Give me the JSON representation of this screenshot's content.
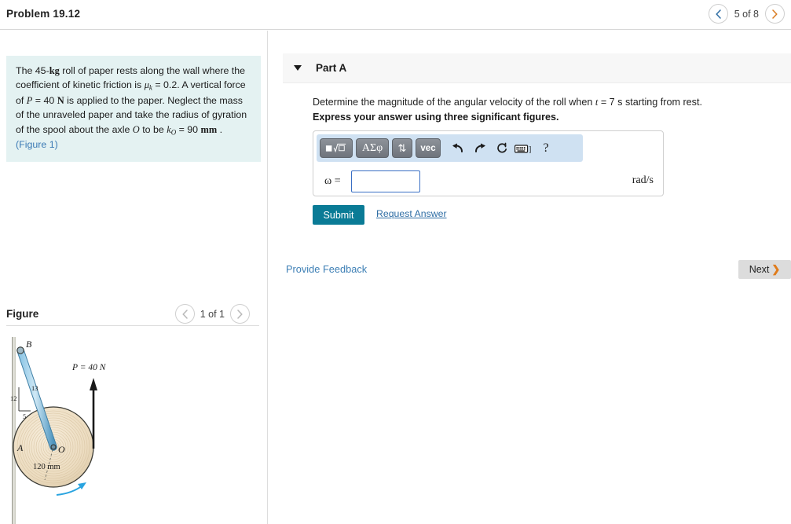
{
  "header": {
    "problem_title": "Problem 19.12",
    "prev_icon": "chevron-left-icon",
    "next_icon": "chevron-right-icon",
    "pager_label": "5 of 8"
  },
  "statement": {
    "line1_a": "The 45-",
    "line1_kg": "kg",
    "line1_b": " roll of paper rests along the wall where the coefficient of kinetic friction is ",
    "mu": "μ",
    "mu_sub": "k",
    "eq_mu": " = 0.2. A vertical force of ",
    "P": "P",
    "eq_P": " = 40 ",
    "N": "N",
    "after_P": " is applied to the paper. Neglect the mass of the unraveled paper and take the radius of gyration of the spool about the axle ",
    "O": "O",
    "to_be": " to be ",
    "k": "k",
    "k_sub": "O",
    "eq_k": " = 90 ",
    "mm": "mm",
    "period": " . ",
    "figure_link": "(Figure 1)"
  },
  "figure_panel": {
    "title": "Figure",
    "prev_icon": "chevron-left-icon",
    "next_icon": "chevron-right-icon",
    "pager_label": "1 of 1"
  },
  "figure": {
    "label_B": "B",
    "label_A": "A",
    "label_O": "O",
    "label_12": "12",
    "label_13": "13",
    "label_5": "5",
    "label_radius": "120 mm",
    "label_force": "P = 40 N",
    "colors": {
      "bar": "#6aaed6",
      "roll": "#efdfc4",
      "arrow": "#1a1a1a",
      "rotation_arrow": "#2aa4e0",
      "wall": "#c9c9c0"
    }
  },
  "part": {
    "caret_icon": "caret-down-icon",
    "label": "Part A",
    "question_a": "Determine the magnitude of the angular velocity of the roll when ",
    "question_t": "t",
    "question_b": " = 7  s starting from rest.",
    "instruction": "Express your answer using three significant figures."
  },
  "toolbar": {
    "buttons": [
      {
        "name": "template-button",
        "glyph": "■√□"
      },
      {
        "name": "greek-symbols-button",
        "glyph": "ΑΣφ"
      },
      {
        "name": "updown-arrows-button",
        "glyph": "⇅"
      },
      {
        "name": "vector-button",
        "glyph": "vec"
      }
    ],
    "icons": [
      {
        "name": "undo-icon",
        "glyph": "↶"
      },
      {
        "name": "redo-icon",
        "glyph": "↷"
      },
      {
        "name": "reset-icon",
        "glyph": "↻"
      },
      {
        "name": "keyboard-icon",
        "glyph": "⌨]"
      },
      {
        "name": "help-icon",
        "glyph": "?"
      }
    ]
  },
  "answer": {
    "omega_label": "ω =",
    "value": "",
    "placeholder": "",
    "units": "rad/s"
  },
  "actions": {
    "submit_label": "Submit",
    "request_answer_label": "Request Answer",
    "feedback_label": "Provide Feedback",
    "next_label": "Next",
    "next_chevron": "❯"
  },
  "colors": {
    "accent_teal": "#0a7b96",
    "link_blue": "#2e6da4",
    "statement_bg": "#e4f2f2",
    "mathbar_bg": "#cfe1f2",
    "next_btn_bg": "#dcdcdc",
    "next_chevron": "#e07b1a"
  }
}
